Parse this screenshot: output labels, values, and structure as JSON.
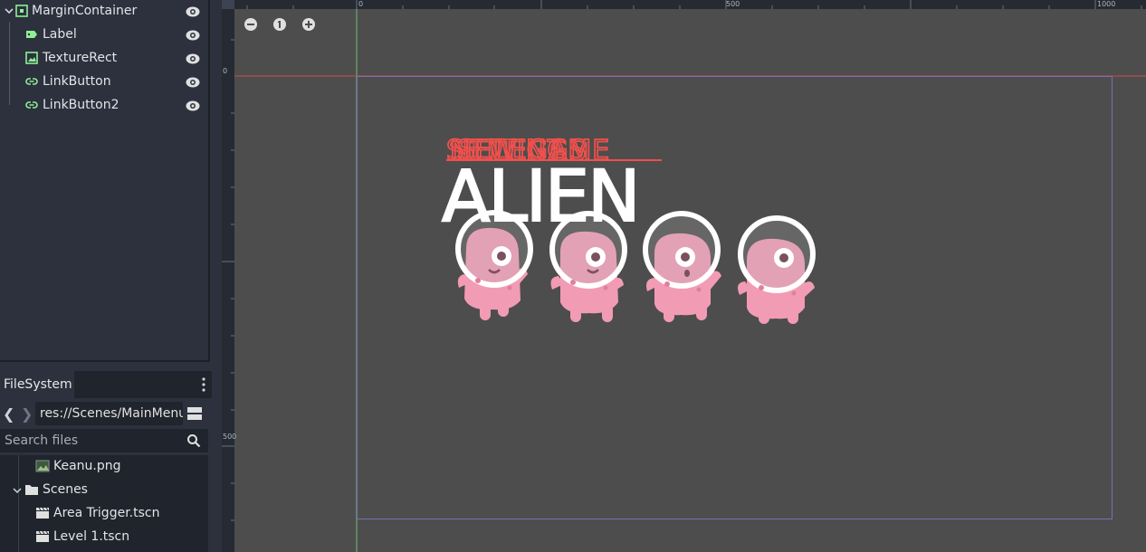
{
  "scene_tree": {
    "items": [
      {
        "label": "MarginContainer",
        "icon": "margin-container-icon"
      },
      {
        "label": "Label",
        "icon": "label-icon"
      },
      {
        "label": "TextureRect",
        "icon": "texture-rect-icon"
      },
      {
        "label": "LinkButton",
        "icon": "link-button-icon"
      },
      {
        "label": "LinkButton2",
        "icon": "link-button-icon"
      }
    ]
  },
  "filesystem": {
    "tab_label": "FileSystem",
    "path": "res://Scenes/MainMenu.tscn",
    "search_placeholder": "Search files",
    "items": [
      {
        "label": "Keanu.png",
        "icon": "image-file-icon"
      },
      {
        "label": "Scenes",
        "icon": "folder-icon"
      },
      {
        "label": "Area Trigger.tscn",
        "icon": "scene-file-icon"
      },
      {
        "label": "Level 1.tscn",
        "icon": "scene-file-icon"
      }
    ]
  },
  "viewport": {
    "zoom_in": "+",
    "zoom_out": "−",
    "zoom_reset": "1",
    "ruler": {
      "top_labels": [
        "0",
        "500",
        "1000"
      ],
      "left_labels": [
        "0",
        "500"
      ]
    },
    "scene_text": {
      "menu_buttons_overlap": "SELECT",
      "menu_buttons_overlap_2": "NEW GAME",
      "menu_buttons_overlap_3": "SETTINGS",
      "title_line": "ALIEN"
    },
    "colors": {
      "canvas": "#4d4d4d",
      "accent_red": "#f0504c",
      "alien_pink": "#f29bb5",
      "guide_green": "#6fbd6f",
      "guide_red": "#d34b4b"
    }
  }
}
